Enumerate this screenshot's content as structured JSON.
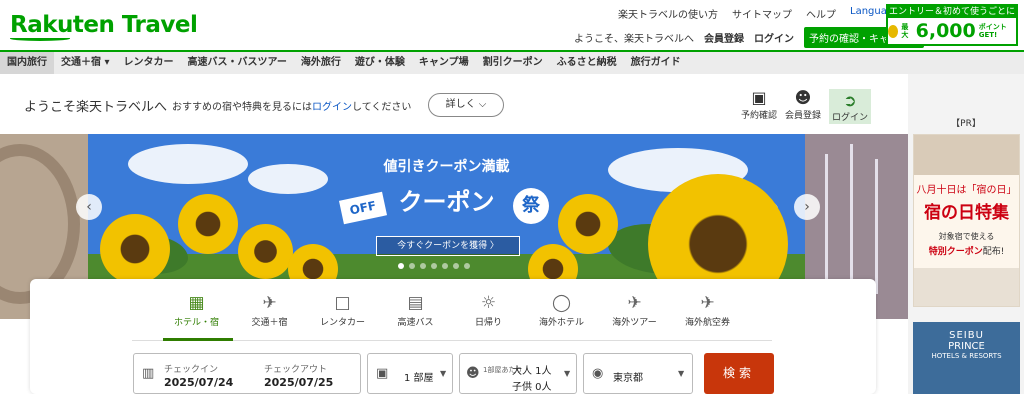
{
  "header": {
    "logo": "Rakuten Travel",
    "top_links": [
      "楽天トラベルの使い方",
      "サイトマップ",
      "ヘルプ"
    ],
    "languages": "Languages ▾",
    "welcome": "ようこそ、楽天トラベルへ",
    "member_register": "会員登録",
    "login": "ログイン",
    "reservation_btn": "予約の確認・キャンセル",
    "promo_top": "エントリー＆初めて使うごとに",
    "promo_prefix": "最大",
    "promo_amount": "6,000",
    "promo_suffix": "ポイントGET!"
  },
  "nav": [
    "国内旅行",
    "交通＋宿 ▾",
    "レンタカー",
    "高速バス・バスツアー",
    "海外旅行",
    "遊び・体験",
    "キャンプ場",
    "割引クーポン",
    "ふるさと納税",
    "旅行ガイド"
  ],
  "welcome_bar": {
    "title": "ようこそ楽天トラベルへ",
    "sub_before": "おすすめの宿や特典を見るには",
    "sub_link": "ログイン",
    "sub_after": "してください",
    "detail_btn": "詳しく ⌵",
    "icon_reservation": "予約確認",
    "icon_register": "会員登録",
    "icon_login": "ログイン"
  },
  "hero": {
    "title": "値引きクーポン満載",
    "coupon": "クーポン",
    "off": "OFF",
    "matsuri": "祭",
    "cta": "今すぐクーポンを獲得 〉",
    "slide_count": 7,
    "active_slide": 0
  },
  "sidebar": {
    "pr": "【PR】",
    "ad1_line1": "八月十日は「宿の日」",
    "ad1_line2": "宿の日特集",
    "ad1_line3": "対象宿で使える",
    "ad1_line4a": "特別クーポン",
    "ad1_line4b": "配布!",
    "ad2_line1": "SEIBU",
    "ad2_line2": "PRINCE",
    "ad2_line3": "HOTELS & RESORTS"
  },
  "search": {
    "tabs": [
      {
        "label": "ホテル・宿",
        "icon": "hotel-icon",
        "active": true
      },
      {
        "label": "交通＋宿",
        "icon": "plane-hotel-icon",
        "active": false
      },
      {
        "label": "レンタカー",
        "icon": "car-icon",
        "active": false
      },
      {
        "label": "高速バス",
        "icon": "bus-icon",
        "active": false
      },
      {
        "label": "日帰り",
        "icon": "sun-icon",
        "active": false
      },
      {
        "label": "海外ホテル",
        "icon": "globe-hotel-icon",
        "active": false
      },
      {
        "label": "海外ツアー",
        "icon": "tour-icon",
        "active": false
      },
      {
        "label": "海外航空券",
        "icon": "airplane-icon",
        "active": false
      }
    ],
    "checkin_label": "チェックイン",
    "checkin_value": "2025/07/24",
    "checkout_label": "チェックアウト",
    "checkout_value": "2025/07/25",
    "rooms": "1 部屋",
    "per_room": "1部屋あたり",
    "adults": "大人 1人",
    "children": "子供 0人",
    "destination": "東京都",
    "search_btn": "検索"
  }
}
